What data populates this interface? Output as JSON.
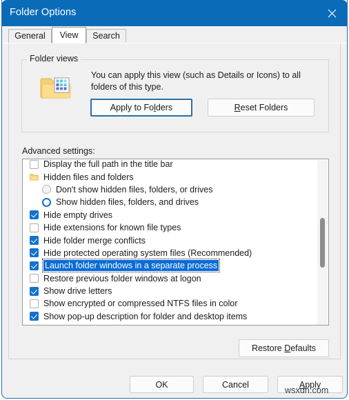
{
  "window": {
    "title": "Folder Options",
    "close_icon": "close-icon",
    "accent_color": "#0a6cb8",
    "selection_color": "#0a6cd8",
    "checkbox_color": "#1272ce"
  },
  "tabs": [
    {
      "label": "General",
      "active": false
    },
    {
      "label": "View",
      "active": true
    },
    {
      "label": "Search",
      "active": false
    }
  ],
  "folder_views": {
    "legend": "Folder views",
    "icon": "folder-with-icons-view-icon",
    "description": "You can apply this view (such as Details or Icons) to all folders of this type.",
    "apply_button": "Apply to Folders",
    "apply_button_pre": "Apply to Fo",
    "apply_button_acc": "l",
    "apply_button_post": "ders",
    "reset_button": "Reset Folders",
    "reset_button_acc": "R",
    "reset_button_post": "eset Folders"
  },
  "advanced": {
    "label": "Advanced settings:",
    "items": [
      {
        "type": "checkbox",
        "checked": false,
        "indent": 0,
        "label": "Display the full path in the title bar",
        "selected": false
      },
      {
        "type": "folder",
        "checked": false,
        "indent": 0,
        "label": "Hidden files and folders",
        "selected": false
      },
      {
        "type": "radio",
        "checked": false,
        "indent": 1,
        "label": "Don't show hidden files, folders, or drives",
        "selected": false
      },
      {
        "type": "radio",
        "checked": true,
        "indent": 1,
        "label": "Show hidden files, folders, and drives",
        "selected": false
      },
      {
        "type": "checkbox",
        "checked": true,
        "indent": 0,
        "label": "Hide empty drives",
        "selected": false
      },
      {
        "type": "checkbox",
        "checked": false,
        "indent": 0,
        "label": "Hide extensions for known file types",
        "selected": false
      },
      {
        "type": "checkbox",
        "checked": true,
        "indent": 0,
        "label": "Hide folder merge conflicts",
        "selected": false
      },
      {
        "type": "checkbox",
        "checked": true,
        "indent": 0,
        "label": "Hide protected operating system files (Recommended)",
        "selected": false
      },
      {
        "type": "checkbox",
        "checked": true,
        "indent": 0,
        "label": "Launch folder windows in a separate process",
        "selected": true
      },
      {
        "type": "checkbox",
        "checked": false,
        "indent": 0,
        "label": "Restore previous folder windows at logon",
        "selected": false
      },
      {
        "type": "checkbox",
        "checked": true,
        "indent": 0,
        "label": "Show drive letters",
        "selected": false
      },
      {
        "type": "checkbox",
        "checked": false,
        "indent": 0,
        "label": "Show encrypted or compressed NTFS files in color",
        "selected": false
      },
      {
        "type": "checkbox",
        "checked": true,
        "indent": 0,
        "label": "Show pop-up description for folder and desktop items",
        "selected": false
      },
      {
        "type": "checkbox",
        "checked": true,
        "indent": 0,
        "label": "",
        "selected": false
      }
    ],
    "restore_defaults": "Restore Defaults",
    "restore_defaults_pre": "Restore ",
    "restore_defaults_acc": "D",
    "restore_defaults_post": "efaults"
  },
  "footer": {
    "ok": "OK",
    "cancel": "Cancel",
    "apply_acc": "A",
    "apply_post": "pply"
  },
  "watermark": "wsxdn.com"
}
